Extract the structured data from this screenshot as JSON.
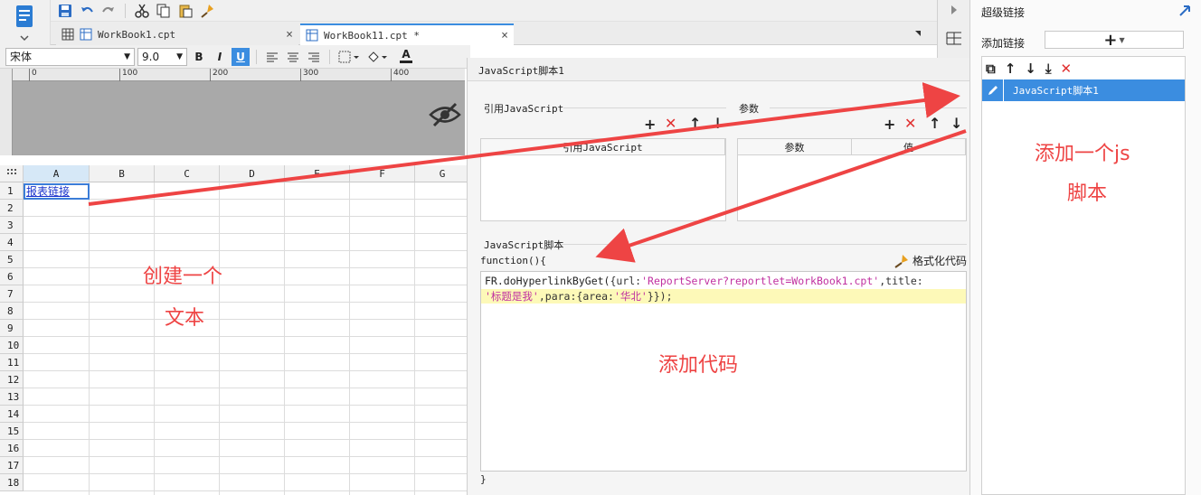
{
  "toolbar": {
    "icons": [
      "save-icon",
      "undo-icon",
      "redo-icon",
      "cut-icon",
      "copy-icon",
      "paste-icon",
      "format-painter-icon"
    ]
  },
  "tabs": [
    {
      "label": "WorkBook1.cpt",
      "close": "×"
    },
    {
      "label": "WorkBook11.cpt *",
      "close": "×"
    }
  ],
  "format": {
    "font_name": "宋体",
    "font_size": "9.0",
    "bold": "B",
    "italic": "I",
    "underline": "U",
    "text_color_label": "A"
  },
  "ruler": {
    "ticks": [
      "0",
      "100",
      "200",
      "300",
      "400"
    ]
  },
  "grid": {
    "columns": [
      "A",
      "B",
      "C",
      "D",
      "E",
      "F",
      "G"
    ],
    "rows": [
      "1",
      "2",
      "3",
      "4",
      "5",
      "6",
      "7",
      "8",
      "9",
      "10",
      "11",
      "12",
      "13",
      "14",
      "15",
      "16",
      "17",
      "18"
    ],
    "cell_a1": "报表链接"
  },
  "dialog": {
    "title": "JavaScript脚本1",
    "ref_js_label": "引用JavaScript",
    "params_label": "参数",
    "ref_js_col": "引用JavaScript",
    "params_col": "参数",
    "value_col": "值",
    "js_script_label": "JavaScript脚本",
    "func_open": "function(){",
    "format_code": "格式化代码",
    "func_close": "}",
    "code": {
      "l1_a": "FR.doHyperlinkByGet(",
      "l1_b": "{url:",
      "l1_c": "'ReportServer?reportlet=WorkBook1.cpt'",
      "l1_d": ",title:",
      "l2_a": "'标题是我'",
      "l2_b": ",para:",
      "l2_c": "{area:",
      "l2_d": "'华北'",
      "l2_e": "}});"
    }
  },
  "right_panel": {
    "title": "超级链接",
    "add_link_label": "添加链接",
    "add_button": "+",
    "list_item": "JavaScript脚本1"
  },
  "annotations": {
    "create_text_1": "创建一个",
    "create_text_2": "文本",
    "add_code": "添加代码",
    "add_js_1": "添加一个js",
    "add_js_2": "脚本"
  },
  "colors": {
    "accent": "#3b8de0",
    "annotation": "#ee4444",
    "delete_red": "#e03030"
  }
}
